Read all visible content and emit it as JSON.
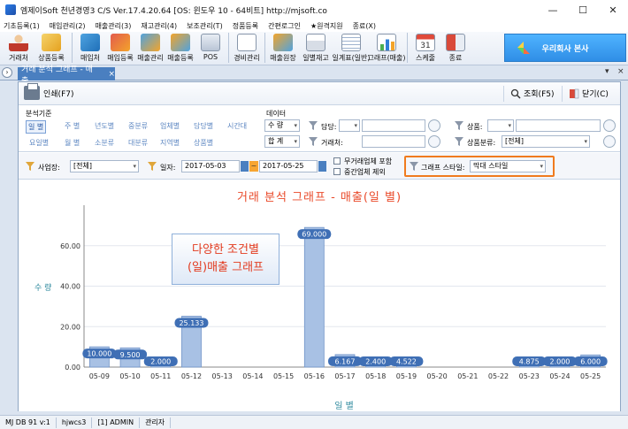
{
  "titlebar": {
    "title": "엠제이Soft 천년경영3 C/S   Ver.17.4.20.64  [OS: 윈도우 10 - 64비트]   http://mjsoft.co",
    "minimize": "—",
    "maximize": "☐",
    "close": "✕"
  },
  "menu": [
    "기초등록(1)",
    "매입관리(2)",
    "매출관리(3)",
    "재고관리(4)",
    "보조관리(T)",
    "정품등록",
    "간편로그인",
    "★원격지원",
    "종료(X)"
  ],
  "toolbar": {
    "buttons": [
      {
        "label": "거래처",
        "icon": "client-icon"
      },
      {
        "label": "상품등록",
        "icon": "product-icon"
      },
      {
        "label": "매입처",
        "icon": "supplier-icon"
      },
      {
        "label": "매입등록",
        "icon": "purchase-icon"
      },
      {
        "label": "매출관리",
        "icon": "sales-manage-icon"
      },
      {
        "label": "매출등록",
        "icon": "sales-entry-icon"
      },
      {
        "label": "POS",
        "icon": "pos-icon"
      },
      {
        "label": "경비관리",
        "icon": "expense-icon"
      },
      {
        "label": "매출원장",
        "icon": "ledger-icon"
      },
      {
        "label": "일별재고",
        "icon": "daily-stock-icon"
      },
      {
        "label": "일계표(일반)",
        "icon": "daily-report-icon"
      },
      {
        "label": "그래프(매출)",
        "icon": "graph-icon"
      },
      {
        "label": "스케줄",
        "icon": "calendar-icon"
      },
      {
        "label": "종료",
        "icon": "exit-icon"
      }
    ],
    "calendar_day": "31",
    "company_label": "우리회사 본사"
  },
  "tabs": {
    "active": "거래 분석 그래프 - 매출",
    "close": "×",
    "pin": "▾",
    "close_all": "×"
  },
  "doc_toolbar": {
    "print": "인쇄(F7)",
    "search": "조회(F5)",
    "close": "닫기(C)"
  },
  "filters": {
    "group_title": "분석기준",
    "criteria_row1": [
      "일 별",
      "주 별",
      "년도별",
      "중분류",
      "업체별",
      "담당별",
      "시간대"
    ],
    "criteria_row2": [
      "요일별",
      "월 별",
      "소분류",
      "대분류",
      "지역별",
      "상품별"
    ],
    "data_title": "데이터",
    "data_value": "수 량",
    "sum_value": "합 계",
    "manager_label": "담당:",
    "client_label": "거래처:",
    "product_label": "상품:",
    "category_label": "상품분류:",
    "category_value": "[전체]",
    "site_label": "사업장:",
    "site_value": "[전체]",
    "date_label": "일자:",
    "date_from": "2017-05-03",
    "date_to": "2017-05-25",
    "date_sep": "~",
    "check1": "무거래업체 포함",
    "check2": "중간업체 제외",
    "style_label": "그래프 스타일:",
    "style_value": "막대 스타일"
  },
  "callout": {
    "line1": "다양한 조건별",
    "line2": "(일)매출 그래프"
  },
  "chart_data": {
    "type": "bar",
    "title": "거래 분석 그래프 - 매출(일   별)",
    "xlabel": "일   별",
    "ylabel": "수 량",
    "ylim": [
      0,
      80
    ],
    "yticks": [
      "0.00",
      "20.00",
      "40.00",
      "60.00"
    ],
    "categories": [
      "05-09",
      "05-10",
      "05-11",
      "05-12",
      "05-13",
      "05-14",
      "05-15",
      "05-16",
      "05-17",
      "05-18",
      "05-19",
      "05-20",
      "05-21",
      "05-22",
      "05-23",
      "05-24",
      "05-25"
    ],
    "values": [
      10.0,
      9.5,
      2.0,
      25.133,
      0,
      0,
      0,
      69.0,
      6.167,
      2.4,
      4.522,
      0,
      0,
      0,
      4.875,
      2.0,
      6.0
    ],
    "value_labels": [
      "10.000",
      "9.500",
      "2.000",
      "25.133",
      "",
      "",
      "",
      "69.000",
      "6.167",
      "2.400",
      "4.522",
      "",
      "",
      "",
      "4.875",
      "2.000",
      "6.000"
    ],
    "bar_color": "#a8c1e4",
    "grid": true
  },
  "status": [
    "MJ DB 91 v:1",
    "hjwcs3",
    "[1] ADMIN",
    "관리자"
  ]
}
